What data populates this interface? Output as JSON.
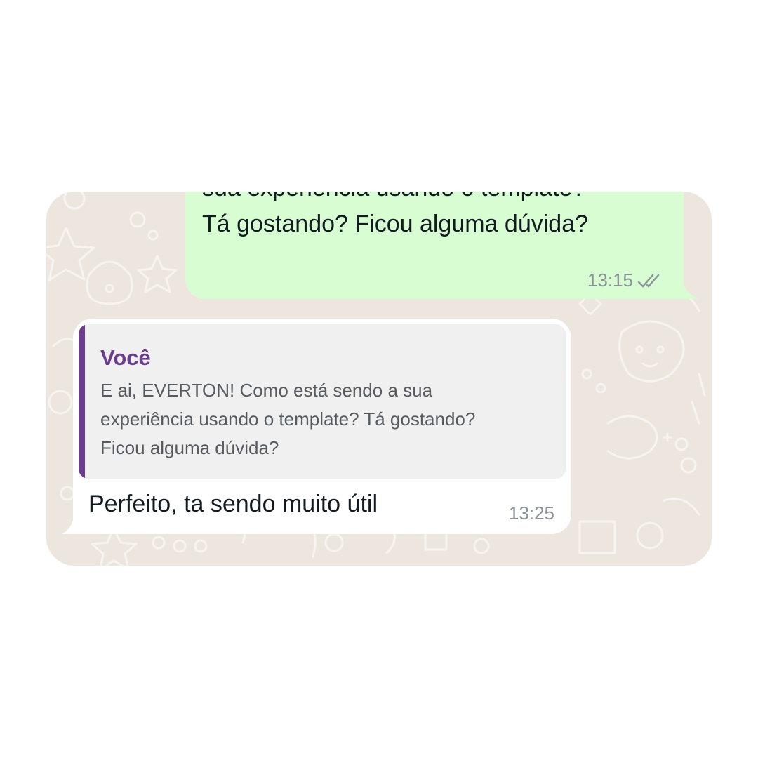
{
  "outgoing_message": {
    "text": "sua experiência usando o template?\nTá gostando? Ficou alguma dúvida?",
    "time": "13:15",
    "status_icon": "double-check-icon",
    "bubble_color": "#d9fdd3"
  },
  "incoming_message": {
    "quote": {
      "author": "Você",
      "text": "E ai, EVERTON! Como está sendo a sua\nexperiência usando o template? Tá gostando?\nFicou alguma dúvida?",
      "accent_color": "#6b3d8c"
    },
    "text": "Perfeito, ta sendo muito útil",
    "time": "13:25",
    "bubble_color": "#ffffff"
  },
  "wallpaper_color": "#ece6df"
}
